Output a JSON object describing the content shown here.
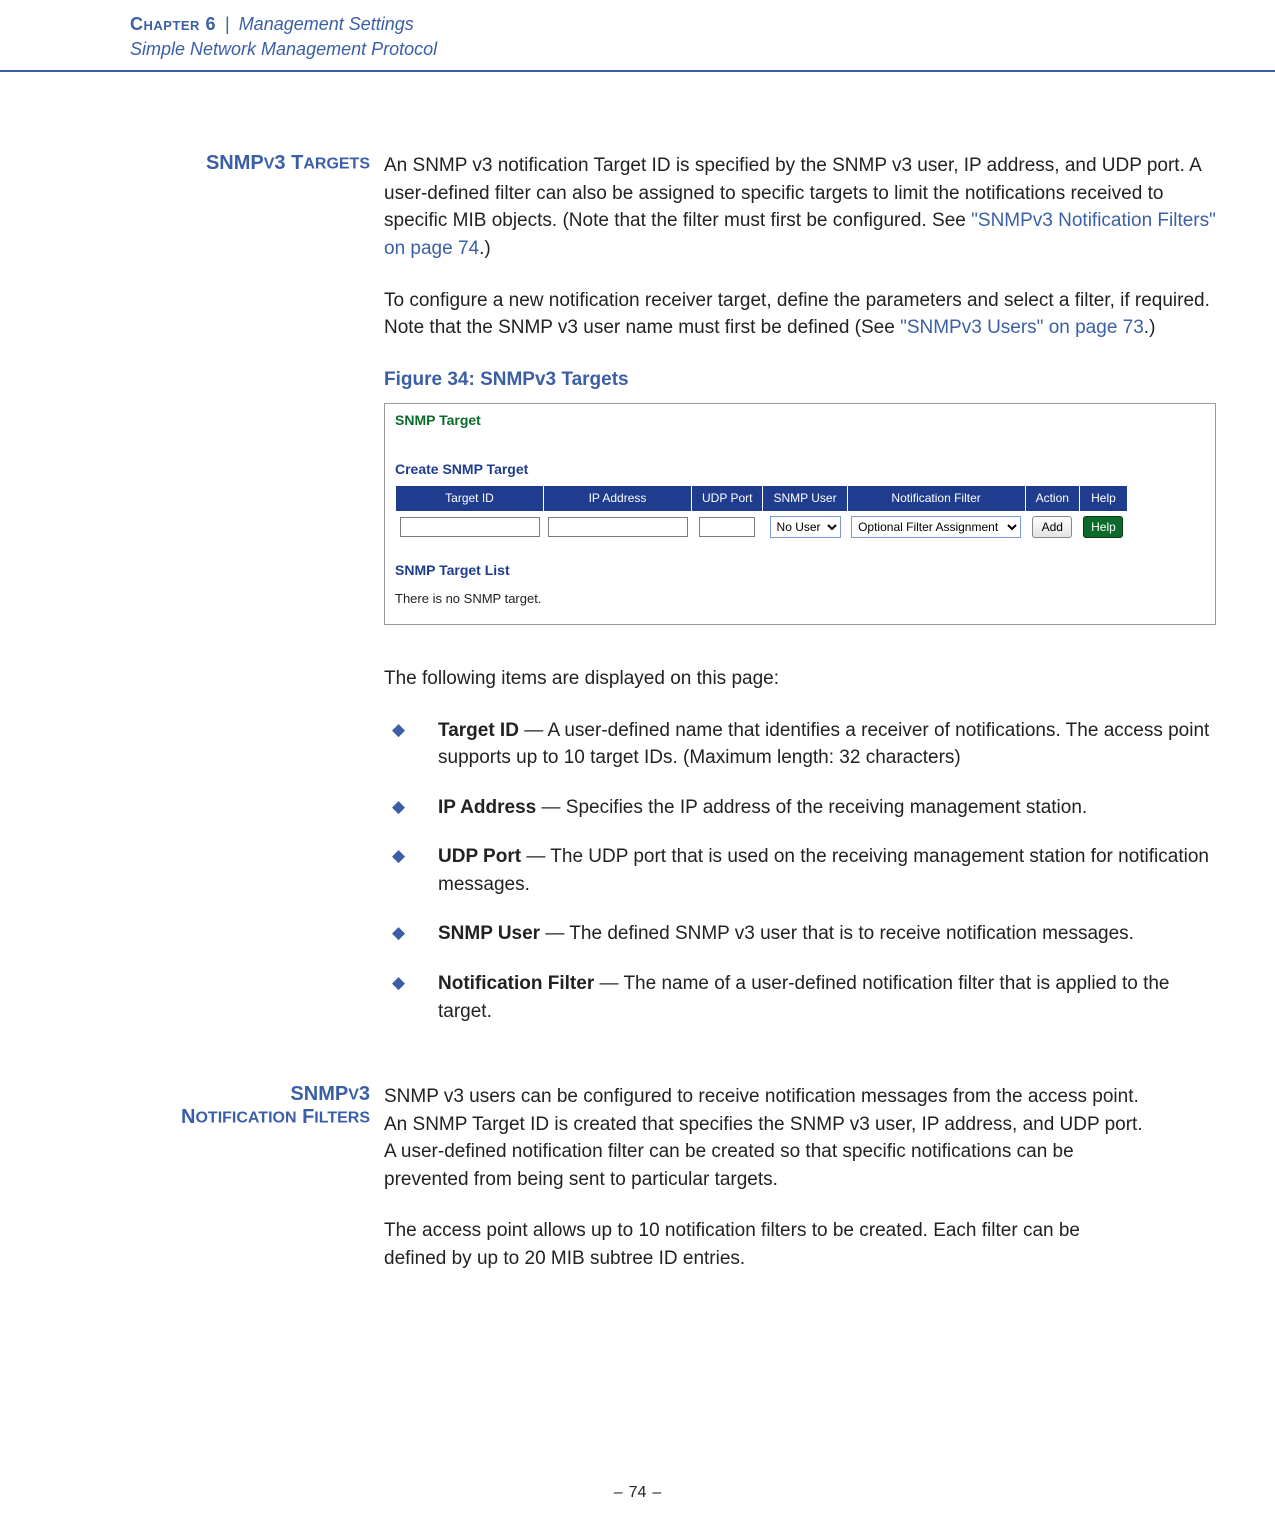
{
  "header": {
    "chapter_label": "Chapter 6",
    "chapter_title": "Management Settings",
    "subtitle": "Simple Network Management Protocol"
  },
  "section1": {
    "heading_pre": "SNMP",
    "heading_sc": "V",
    "heading_post": "3 T",
    "heading_sc2": "ARGETS",
    "para1_a": "An SNMP v3 notification Target ID is specified by the SNMP v3 user, IP address, and UDP port. A user-defined filter can also be assigned to specific targets to limit the notifications received to specific MIB objects. (Note that the filter must first be configured. See ",
    "para1_link": "\"SNMPv3 Notification Filters\" on page 74",
    "para1_c": ".)",
    "para2_a": "To configure a new notification receiver target, define the parameters and select a filter, if required. Note that the SNMP v3 user name must first be defined (See ",
    "para2_link": "\"SNMPv3 Users\" on page 73",
    "para2_c": ".)",
    "fig_caption": "Figure 34:  SNMPv3 Targets",
    "fig": {
      "title": "SNMP Target",
      "subtitle": "Create SNMP Target",
      "columns": [
        "Target ID",
        "IP Address",
        "UDP Port",
        "SNMP User",
        "Notification Filter",
        "Action",
        "Help"
      ],
      "snmp_user_options": [
        "No User"
      ],
      "filter_options": [
        "Optional Filter Assignment"
      ],
      "add_label": "Add",
      "help_label": "Help",
      "list_title": "SNMP Target List",
      "list_empty": "There is no SNMP target."
    },
    "items_intro": "The following items are displayed on this page:",
    "items": [
      {
        "term": "Target ID",
        "desc": " — A user-defined name that identifies a receiver of notifications. The access point supports up to 10 target IDs. (Maximum length: 32 characters)"
      },
      {
        "term": "IP Address",
        "desc": " — Specifies the IP address of the receiving management station."
      },
      {
        "term": "UDP Port",
        "desc": " — The UDP port that is used on the receiving management station for notification messages."
      },
      {
        "term": "SNMP User",
        "desc": " — The defined SNMP v3 user that is to receive notification messages."
      },
      {
        "term": "Notification Filter",
        "desc": " — The name of a user-defined notification filter that is applied to the target."
      }
    ]
  },
  "section2": {
    "heading_l1_pre": "SNMP",
    "heading_l1_sc": "V",
    "heading_l1_post": "3",
    "heading_l2_pre": "N",
    "heading_l2_sc1": "OTIFICATION",
    "heading_l2_mid": " F",
    "heading_l2_sc2": "ILTERS",
    "para1": "SNMP v3 users can be configured to receive notification messages from the access point. An SNMP Target ID is created that specifies the SNMP v3 user, IP address, and UDP port. A user-defined notification filter can be created so that specific notifications can be prevented from being sent to particular targets.",
    "para2": "The access point allows up to 10 notification filters to be created. Each filter can be defined by up to 20 MIB subtree ID entries."
  },
  "footer": {
    "page": "74"
  }
}
